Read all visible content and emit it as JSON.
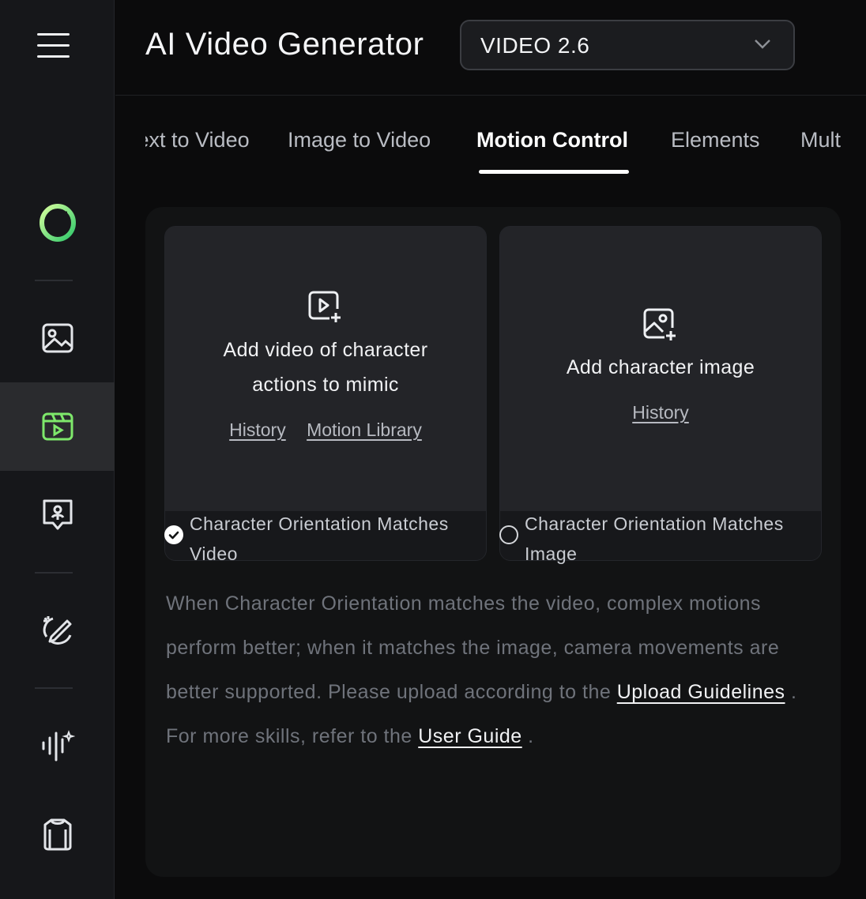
{
  "header": {
    "title": "AI Video Generator",
    "model": "VIDEO 2.6"
  },
  "sidebar": {
    "items": [
      {
        "name": "menu-icon"
      },
      {
        "name": "logo-icon"
      },
      {
        "name": "image-icon"
      },
      {
        "name": "video-icon",
        "active": true
      },
      {
        "name": "avatar-icon"
      },
      {
        "name": "edit-icon"
      },
      {
        "name": "audio-icon"
      },
      {
        "name": "shirt-icon"
      }
    ],
    "accent": "#7ee86b"
  },
  "tabs": [
    {
      "label": "Text to Video"
    },
    {
      "label": "Image to Video"
    },
    {
      "label": "Motion Control"
    },
    {
      "label": "Elements"
    },
    {
      "label": "Multi"
    }
  ],
  "cards": {
    "video": {
      "label_line1": "Add video of character",
      "label_line2": "actions to mimic",
      "link_history": "History",
      "link_library": "Motion Library",
      "option": "Character Orientation Matches Video"
    },
    "image": {
      "label": "Add character image",
      "link_history": "History",
      "option": "Character Orientation Matches Image"
    }
  },
  "description": {
    "text1": "When Character Orientation matches the video, complex motions perform better; when it matches the image, camera movements are better supported. Please upload according to the ",
    "link1": "Upload Guidelines",
    "text2": " . For more skills, refer to the ",
    "link2": "User Guide",
    "text3": " ."
  }
}
